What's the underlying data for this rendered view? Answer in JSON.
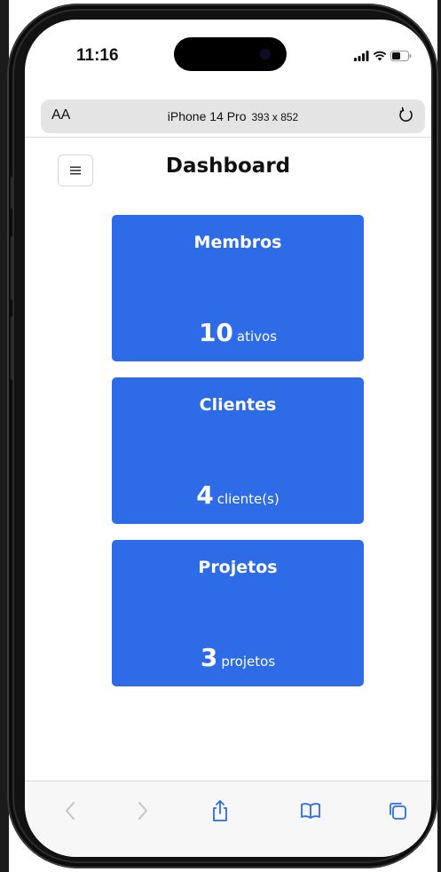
{
  "status_bar": {
    "time": "11:16",
    "icons": [
      "signal-icon",
      "wifi-icon",
      "battery-icon"
    ]
  },
  "browser": {
    "text_size_label": "AA",
    "device_name": "iPhone 14 Pro",
    "device_dimensions": "393 x 852",
    "reload_icon": "reload-icon",
    "toolbar_icons": [
      "back-icon",
      "forward-icon",
      "share-icon",
      "bookmarks-icon",
      "tabs-icon"
    ]
  },
  "page": {
    "title": "Dashboard",
    "menu_icon": "hamburger-menu-icon"
  },
  "cards": [
    {
      "title": "Membros",
      "value": "10",
      "unit": "ativos"
    },
    {
      "title": "Clientes",
      "value": "4",
      "unit": "cliente(s)"
    },
    {
      "title": "Projetos",
      "value": "3",
      "unit": "projetos"
    }
  ],
  "colors": {
    "card_background": "#2e6be6",
    "card_text": "#ffffff",
    "toolbar_icon_active": "#2e6be6",
    "toolbar_icon_disabled": "#c4c4c4"
  }
}
